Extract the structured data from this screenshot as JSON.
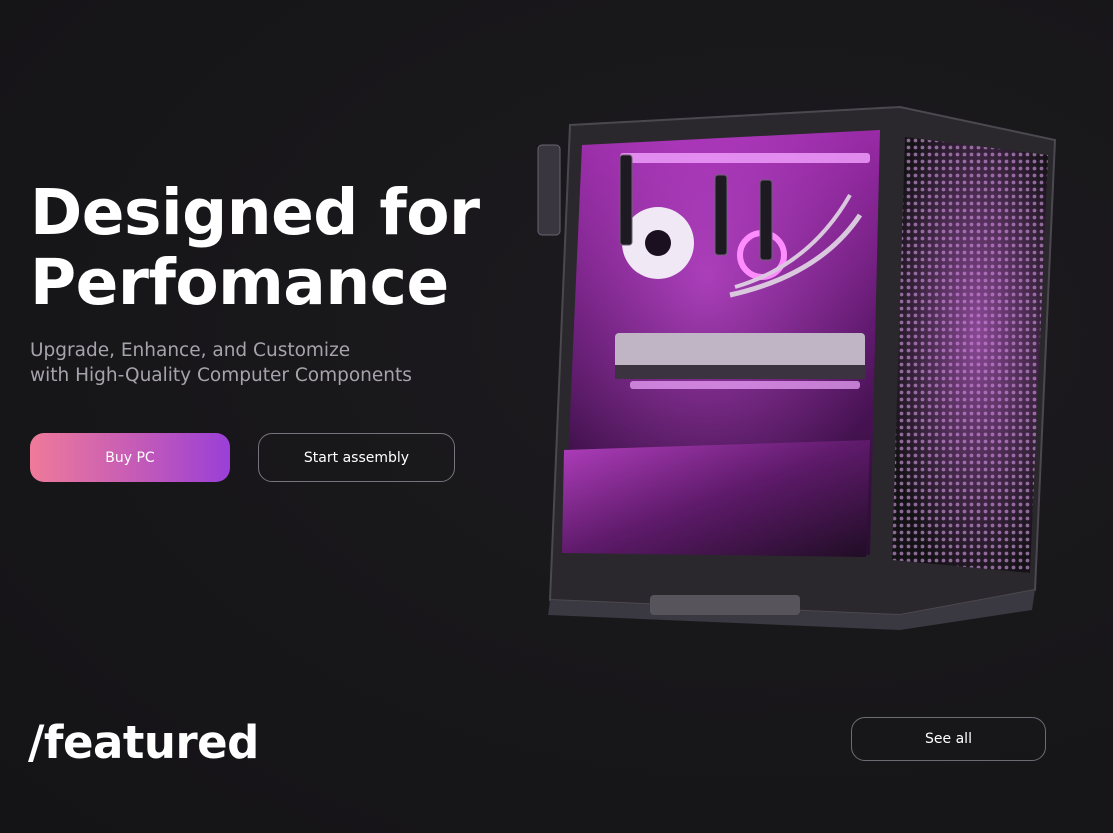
{
  "hero": {
    "title_line1": "Designed for",
    "title_line2": "Perfomance",
    "subtitle_line1": "Upgrade, Enhance, and Customize",
    "subtitle_line2": "with High-Quality Computer Components",
    "buy_label": "Buy PC",
    "assembly_label": "Start assembly"
  },
  "featured": {
    "heading": "/featured",
    "see_all_label": "See all"
  },
  "colors": {
    "background": "#18171a",
    "accent_start": "#ef7a9a",
    "accent_end": "#9a3fd8",
    "glow": "#d04be0"
  },
  "image": {
    "subject": "pc-case-icon"
  }
}
